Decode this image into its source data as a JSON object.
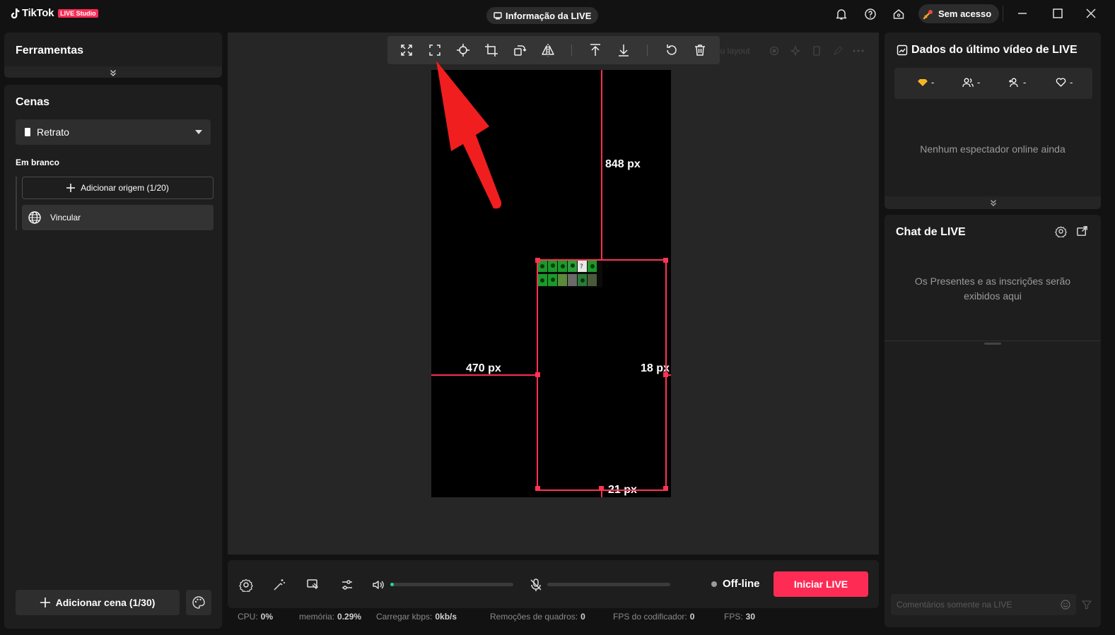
{
  "app": {
    "logo_text": "TikTok",
    "logo_badge": "LIVE Studio"
  },
  "header": {
    "live_info_label": "Informação da LIVE",
    "access_label": "Sem acesso"
  },
  "tools": {
    "title": "Ferramentas"
  },
  "scenes": {
    "title": "Cenas",
    "selected_scene": "Retrato",
    "group_label": "Em branco",
    "add_source_label": "Adicionar origem (1/20)",
    "source_item_label": "Vincular",
    "add_scene_label": "Adicionar cena (1/30)"
  },
  "canvas": {
    "ghost_layout_label": "eu layout",
    "measure_top": "848 px",
    "measure_left": "470 px",
    "measure_right": "18 px",
    "measure_bottom": "21 px"
  },
  "controls": {
    "volume_level": 0.03,
    "mic_level": 0,
    "status_label": "Off-line",
    "start_live_label": "Iniciar LIVE"
  },
  "status": {
    "cpu_label": "CPU:",
    "cpu_value": "0%",
    "memory_label": "memória:",
    "memory_value": "0.29%",
    "upload_label": "Carregar kbps:",
    "upload_value": "0kb/s",
    "dropped_label": "Remoções de quadros:",
    "dropped_value": "0",
    "encoder_fps_label": "FPS do codificador:",
    "encoder_fps_value": "0",
    "fps_label": "FPS:",
    "fps_value": "30"
  },
  "last_live": {
    "title": "Dados do último vídeo de LIVE",
    "diamonds": "-",
    "viewers": "-",
    "new_followers": "-",
    "likes": "-",
    "empty_text": "Nenhum espectador online ainda"
  },
  "chat": {
    "title": "Chat de LIVE",
    "empty_text": "Os Presentes e as inscrições serão exibidos aqui",
    "input_placeholder": "Comentários somente na LIVE"
  },
  "colors": {
    "accent": "#fe2c55",
    "volume": "#20d5a0",
    "selection": "#ff3355"
  }
}
